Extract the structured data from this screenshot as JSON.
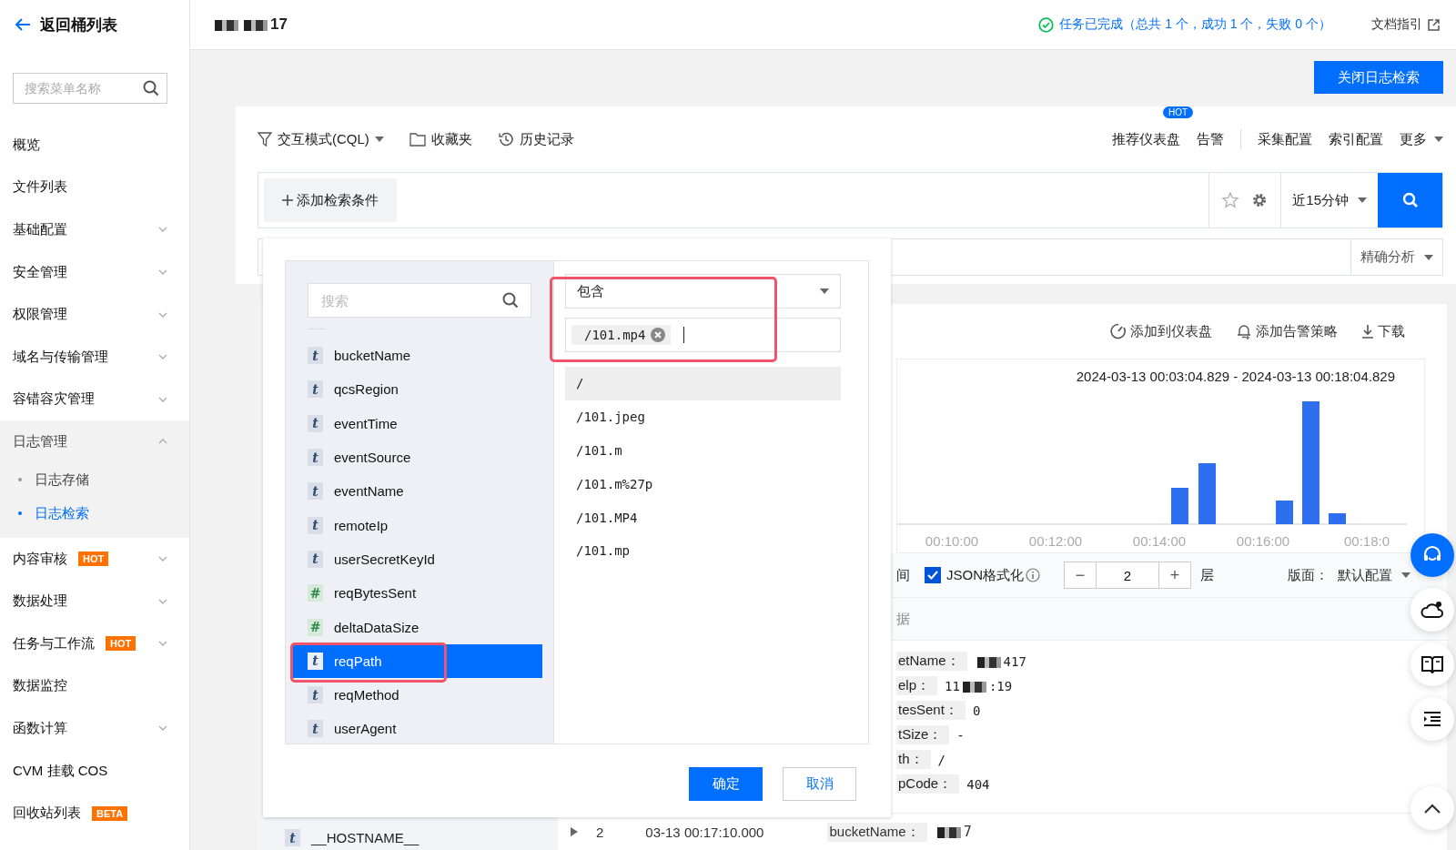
{
  "back_link": {
    "label": "返回桶列表"
  },
  "sidebar": {
    "search": {
      "placeholder": "搜索菜单名称"
    },
    "items": [
      {
        "label": "概览",
        "expandable": false,
        "expanded": false
      },
      {
        "label": "文件列表",
        "expandable": false,
        "expanded": false
      },
      {
        "label": "基础配置",
        "expandable": true,
        "expanded": false
      },
      {
        "label": "安全管理",
        "expandable": true,
        "expanded": false
      },
      {
        "label": "权限管理",
        "expandable": true,
        "expanded": false
      },
      {
        "label": "域名与传输管理",
        "expandable": true,
        "expanded": false
      },
      {
        "label": "容错容灾管理",
        "expandable": true,
        "expanded": false
      },
      {
        "label": "日志管理",
        "expandable": true,
        "expanded": true,
        "children": [
          {
            "label": "日志存储",
            "selected": false
          },
          {
            "label": "日志检索",
            "selected": true
          }
        ]
      },
      {
        "label": "内容审核",
        "expandable": true,
        "expanded": false,
        "badge": "HOT"
      },
      {
        "label": "数据处理",
        "expandable": true,
        "expanded": false
      },
      {
        "label": "任务与工作流",
        "expandable": true,
        "expanded": false,
        "badge": "HOT"
      },
      {
        "label": "数据监控",
        "expandable": false,
        "expanded": false
      },
      {
        "label": "函数计算",
        "expandable": true,
        "expanded": false
      },
      {
        "label": "CVM 挂载 COS",
        "expandable": false,
        "expanded": false
      },
      {
        "label": "回收站列表",
        "expandable": false,
        "expanded": false,
        "badge": "BETA"
      }
    ]
  },
  "header": {
    "title_suffix": "17",
    "status": "任务已完成（总共 1 个，成功 1 个，失败 0 个）",
    "doc_link": "文档指引"
  },
  "close_button": "关闭日志检索",
  "toolbar": {
    "left": [
      {
        "label": "交互模式(CQL)",
        "dropdown": true
      },
      {
        "label": "收藏夹",
        "dropdown": false
      },
      {
        "label": "历史记录",
        "dropdown": false
      }
    ],
    "right_groups": [
      [
        {
          "label": "推荐仪表盘",
          "badge": "HOT",
          "dropdown": false
        },
        {
          "label": "告警",
          "dropdown": false
        }
      ],
      [
        {
          "label": "采集配置",
          "dropdown": false
        },
        {
          "label": "索引配置",
          "dropdown": false
        },
        {
          "label": "更多",
          "dropdown": true
        }
      ]
    ]
  },
  "search_bar": {
    "add_condition": "添加检索条件",
    "time_range": "近15分钟"
  },
  "analysis_mode": "精确分析",
  "results": {
    "actions": [
      {
        "label": "添加到仪表盘"
      },
      {
        "label": "添加告警策略"
      },
      {
        "label": "下载"
      }
    ],
    "chart": {
      "range": "2024-03-13 00:03:04.829 - 2024-03-13 00:18:04.829",
      "x_labels": [
        "00:10:00",
        "00:12:00",
        "00:14:00",
        "00:16:00",
        "00:18:0"
      ]
    },
    "options": {
      "partial_label": "间",
      "json_format": {
        "label": "JSON格式化",
        "checked": true
      },
      "decrement": "−",
      "depth": "2",
      "increment": "+",
      "depth_unit": "层",
      "layout_label": "版面：",
      "layout_value": "默认配置"
    },
    "column_header_partial": "据",
    "entries": [
      {
        "key": "etName：",
        "suffix": "417",
        "redacted": true
      },
      {
        "key": "elp：",
        "prefix": "11",
        "suffix": ":19",
        "redacted": true
      },
      {
        "key": "tesSent：",
        "suffix": "0",
        "redacted": false
      },
      {
        "key": "tSize：",
        "suffix": "-",
        "redacted": false
      },
      {
        "key": "th：",
        "suffix": "/",
        "redacted": false
      },
      {
        "key": "pCode：",
        "suffix": "404",
        "redacted": false
      }
    ],
    "next_row": {
      "index": "2",
      "time": "03-13 00:17:10.000",
      "key": "bucketName：",
      "suffix": "7",
      "redacted": true
    }
  },
  "field_panel_partial": {
    "kind": "text",
    "mark": "t",
    "name": "__HOSTNAME__"
  },
  "popup": {
    "search": {
      "placeholder": "搜索"
    },
    "fields": [
      {
        "kind": "text",
        "mark": "t",
        "name": "bucketName",
        "selected": false
      },
      {
        "kind": "text",
        "mark": "t",
        "name": "qcsRegion",
        "selected": false
      },
      {
        "kind": "text",
        "mark": "t",
        "name": "eventTime",
        "selected": false
      },
      {
        "kind": "text",
        "mark": "t",
        "name": "eventSource",
        "selected": false
      },
      {
        "kind": "text",
        "mark": "t",
        "name": "eventName",
        "selected": false
      },
      {
        "kind": "text",
        "mark": "t",
        "name": "remoteIp",
        "selected": false
      },
      {
        "kind": "text",
        "mark": "t",
        "name": "userSecretKeyId",
        "selected": false
      },
      {
        "kind": "number",
        "mark": "#",
        "name": "reqBytesSent",
        "selected": false
      },
      {
        "kind": "number",
        "mark": "#",
        "name": "deltaDataSize",
        "selected": false
      },
      {
        "kind": "text",
        "mark": "t",
        "name": "reqPath",
        "selected": true
      },
      {
        "kind": "text",
        "mark": "t",
        "name": "reqMethod",
        "selected": false
      },
      {
        "kind": "text",
        "mark": "t",
        "name": "userAgent",
        "selected": false
      }
    ],
    "operator": "包含",
    "tags": [
      "/101.mp4"
    ],
    "suggestions": [
      {
        "value": "/",
        "selected": true
      },
      {
        "value": "/101.jpeg",
        "selected": false
      },
      {
        "value": "/101.m",
        "selected": false
      },
      {
        "value": "/101.m%27p",
        "selected": false
      },
      {
        "value": "/101.MP4",
        "selected": false
      },
      {
        "value": "/101.mp",
        "selected": false
      }
    ],
    "confirm": "确定",
    "cancel": "取消"
  }
}
